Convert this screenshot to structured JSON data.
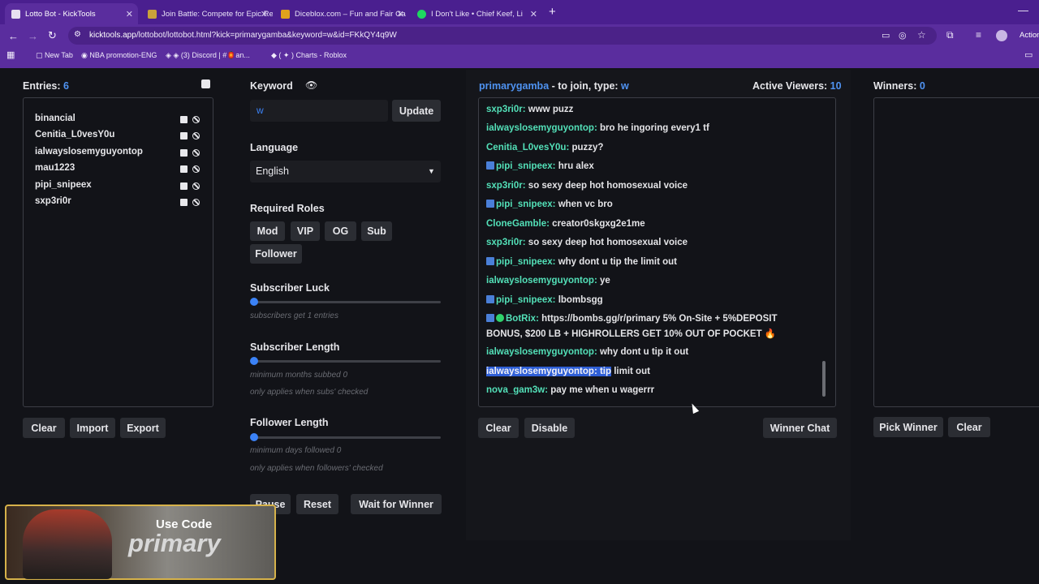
{
  "browser": {
    "tabs": [
      {
        "title": "Lotto Bot - KickTools",
        "active": true
      },
      {
        "title": "Join Battle: Compete for Epic Re",
        "active": false
      },
      {
        "title": "Diceblox.com – Fun and Fair Ga",
        "active": false
      },
      {
        "title": "I Don't Like • Chief Keef, Li",
        "active": false
      }
    ],
    "url_host": "kicktools.app",
    "url_path": "/lottobot/lottobot.html?kick=primarygamba&keyword=w&id=FKkQY4q9W",
    "bookmarks": [
      "New Tab",
      "NBA promotion-ENG",
      "(3) Discord | #🏮an...",
      "( ✦ ) Charts - Roblox"
    ],
    "action_label": "Action"
  },
  "entries": {
    "label": "Entries:",
    "count": "6",
    "names": [
      "binancial",
      "Cenitia_L0vesY0u",
      "ialwayslosemyguyontop",
      "mau1223",
      "pipi_snipeex",
      "sxp3ri0r"
    ],
    "buttons": {
      "clear": "Clear",
      "import": "Import",
      "export": "Export"
    }
  },
  "keyword": {
    "label": "Keyword",
    "value": "w",
    "update": "Update",
    "language_label": "Language",
    "language_value": "English",
    "roles_label": "Required Roles",
    "roles": [
      "Mod",
      "VIP",
      "OG",
      "Sub",
      "Follower"
    ],
    "sub_luck_label": "Subscriber Luck",
    "sub_luck_hint_pre": "subscribers get ",
    "sub_luck_value": "1",
    "sub_luck_hint_post": " entries",
    "sub_length_label": "Subscriber Length",
    "sub_length_hint_pre": "minimum months subbed ",
    "sub_length_value": "0",
    "sub_length_note": "only applies when subs' checked",
    "follower_length_label": "Follower Length",
    "follower_length_hint_pre": "minimum days followed ",
    "follower_length_value": "0",
    "follower_length_note": "only applies when followers' checked",
    "buttons": {
      "pause": "Pause",
      "reset": "Reset",
      "wait": "Wait for Winner"
    }
  },
  "chat": {
    "channel": "primarygamba",
    "join_pre": " - to join, type: ",
    "join_keyword": "w",
    "viewers_label": "Active Viewers:",
    "viewers_count": "10",
    "messages": [
      {
        "user": "sxp3ri0r",
        "text": "www puzz",
        "badge": false
      },
      {
        "user": "ialwayslosemyguyontop",
        "text": "bro he ingoring every1 tf",
        "badge": false
      },
      {
        "user": "Cenitia_L0vesY0u",
        "text": "puzzy?",
        "badge": false
      },
      {
        "user": "pipi_snipeex",
        "text": "hru alex",
        "badge": true
      },
      {
        "user": "sxp3ri0r",
        "text": "so sexy deep hot homosexual voice",
        "badge": false
      },
      {
        "user": "pipi_snipeex",
        "text": "when vc bro",
        "badge": true
      },
      {
        "user": "CloneGamble",
        "text": "creator0skgxg2e1me",
        "badge": false
      },
      {
        "user": "sxp3ri0r",
        "text": "so sexy deep hot homosexual voice",
        "badge": false
      },
      {
        "user": "pipi_snipeex",
        "text": "why dont u tip the limit out",
        "badge": true
      },
      {
        "user": "ialwayslosemyguyontop",
        "text": "ye",
        "badge": false
      },
      {
        "user": "pipi_snipeex",
        "text": "lbombsgg",
        "badge": true
      },
      {
        "user": "BotRix",
        "text": "https://bombs.gg/r/primary 5% On-Site + 5%DEPOSIT",
        "text2": "BONUS, $200 LB + HIGHROLLERS GET 10% OUT OF POCKET 🔥",
        "badge": true
      },
      {
        "user": "ialwayslosemyguyontop",
        "text": "why dont u tip it out",
        "badge": false
      },
      {
        "user": "ialwayslosemyguyontop",
        "text": "tip",
        "text_tail": " limit out",
        "badge": false
      },
      {
        "user": "nova_gam3w",
        "text": "pay me when u wagerrr",
        "badge": false
      }
    ],
    "buttons": {
      "clear": "Clear",
      "disable": "Disable",
      "winner_chat": "Winner Chat"
    }
  },
  "winners": {
    "label": "Winners:",
    "count": "0",
    "buttons": {
      "pick": "Pick Winner",
      "clear": "Clear"
    }
  },
  "overlay": {
    "line1": "Use Code",
    "line2": "primary"
  }
}
